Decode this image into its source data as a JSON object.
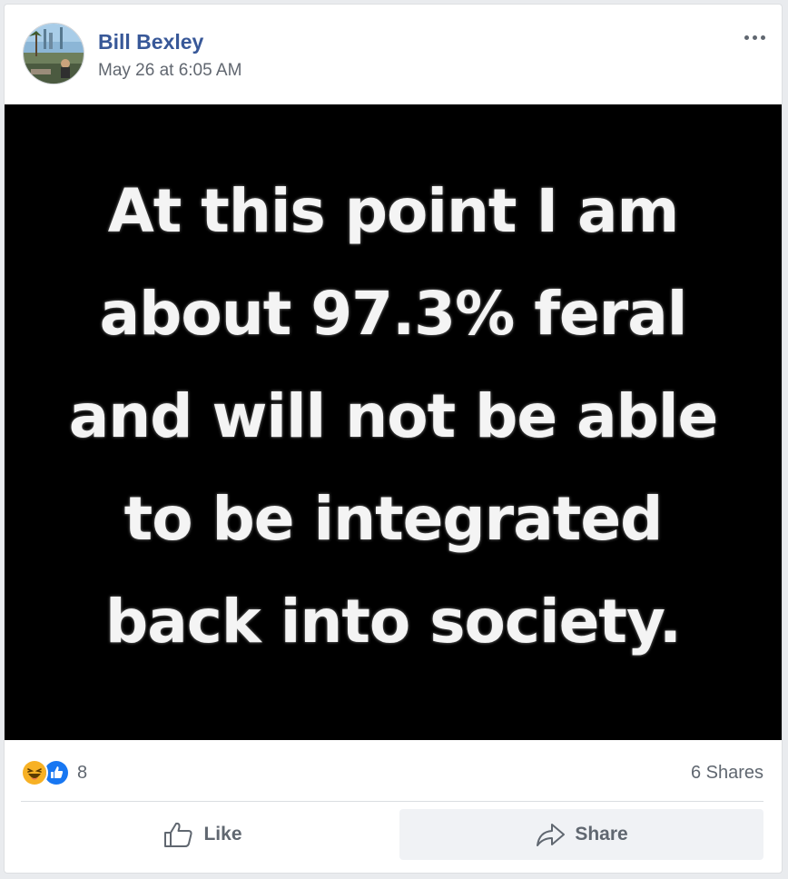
{
  "post": {
    "author": "Bill Bexley",
    "timestamp": "May 26 at 6:05 AM",
    "menu_icon": "more-options-icon",
    "image": {
      "lines": [
        "At this point I am",
        "about 97.3% feral",
        "and will not be able",
        "to be integrated",
        "back into society."
      ],
      "background_color": "#000000",
      "text_color": "#f4f4f4"
    }
  },
  "stats": {
    "reaction_icons": [
      "haha-reaction-icon",
      "like-reaction-icon"
    ],
    "reaction_count": "8",
    "shares": "6 Shares"
  },
  "actions": {
    "like_label": "Like",
    "share_label": "Share"
  },
  "colors": {
    "author_link": "#385898",
    "meta_text": "#616770",
    "like_blue": "#1877f2",
    "haha_yellow": "#f7b125"
  }
}
